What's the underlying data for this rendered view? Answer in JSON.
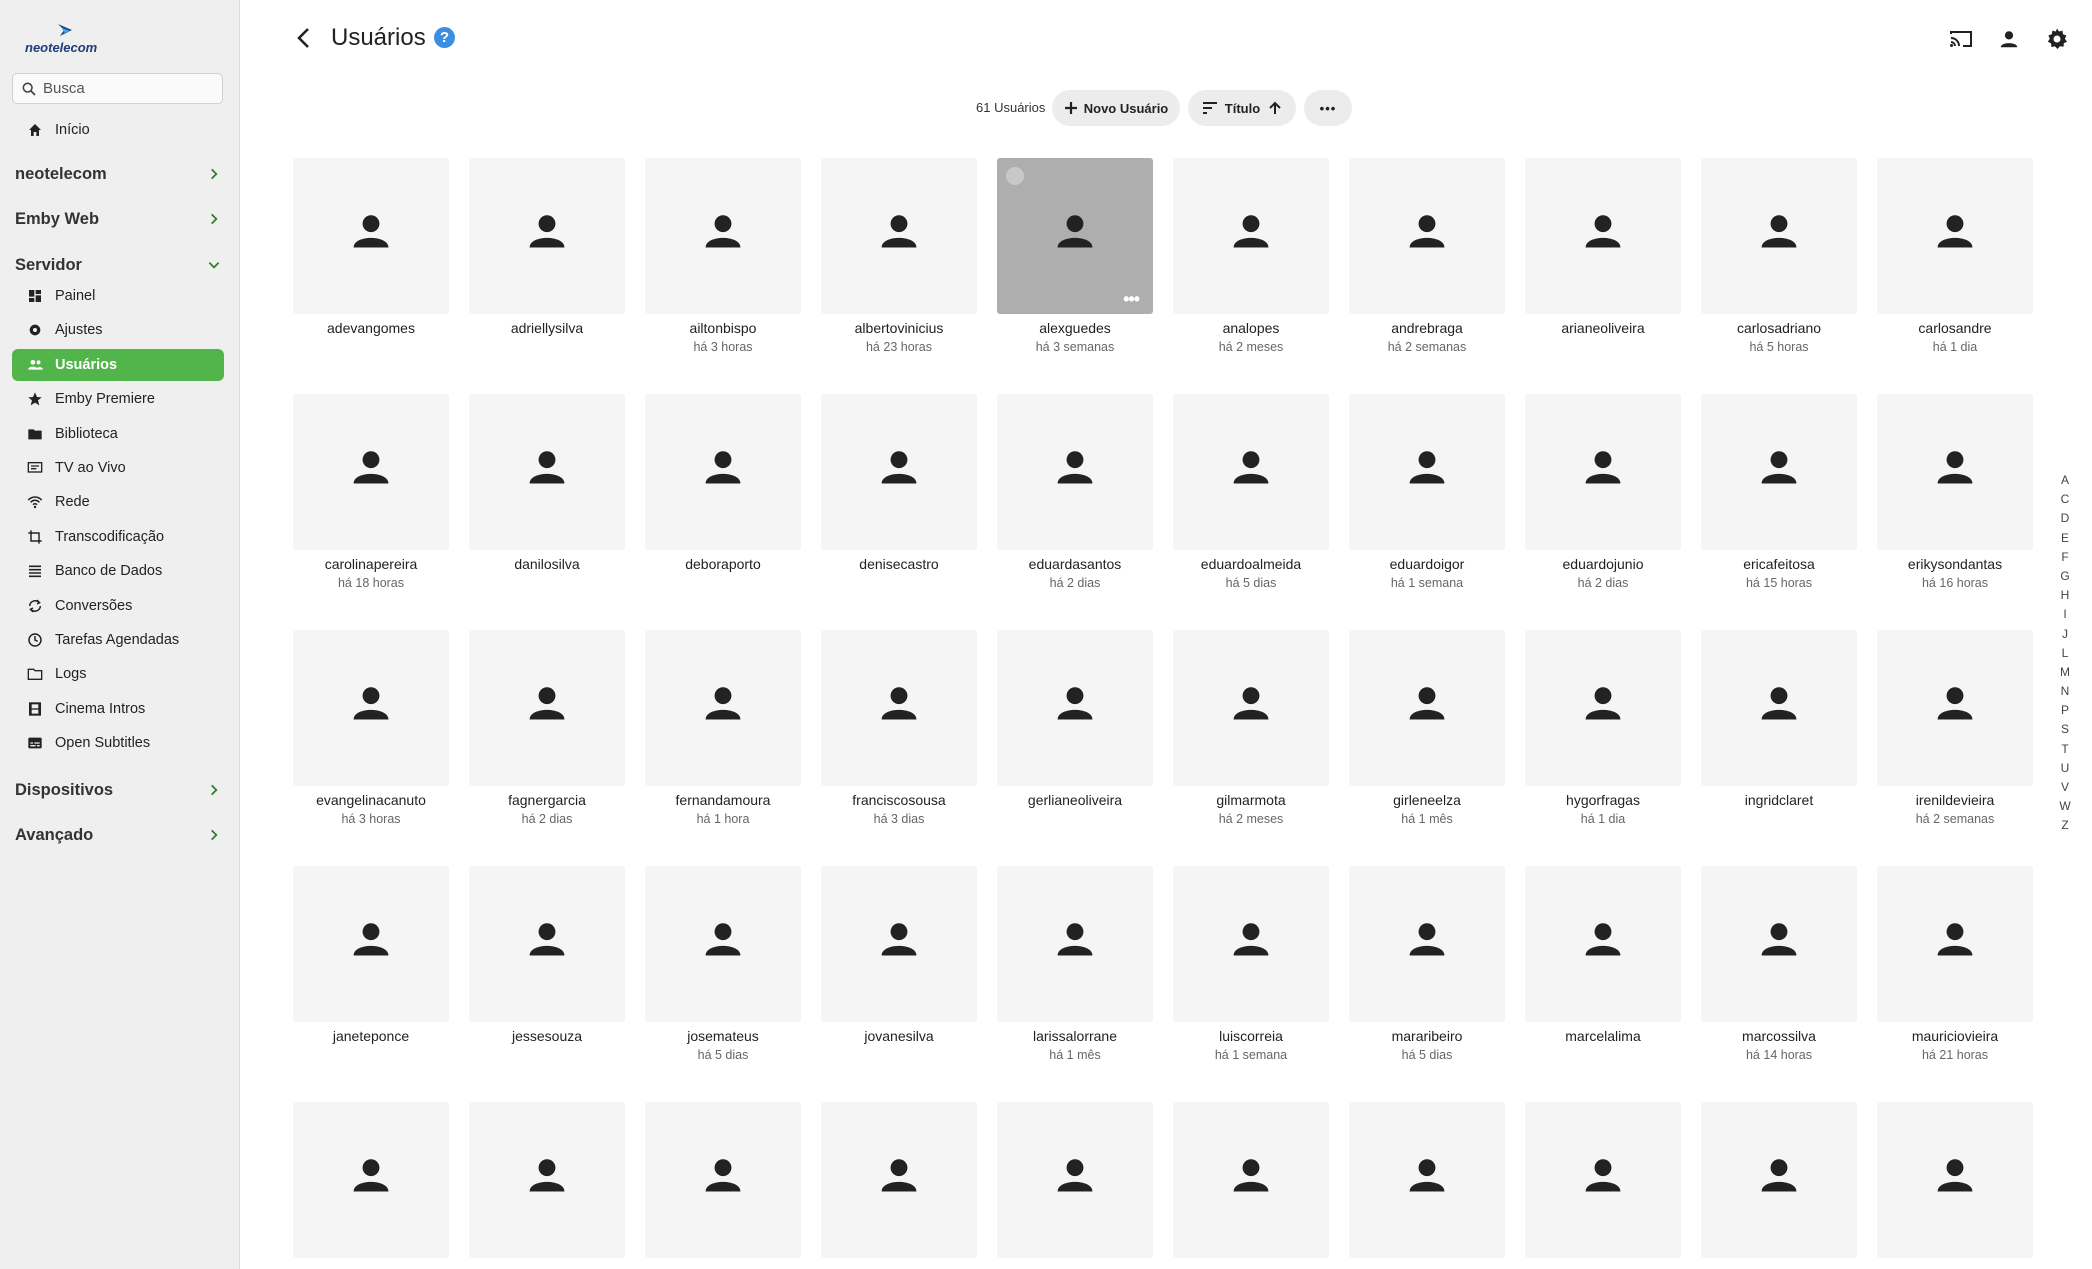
{
  "sidebar": {
    "logo_text": "neotelecom",
    "search_placeholder": "Busca",
    "home_label": "Início",
    "sections": {
      "neotelecom": "neotelecom",
      "emby_web": "Emby Web",
      "servidor": "Servidor",
      "dispositivos": "Dispositivos",
      "avancado": "Avançado"
    },
    "items": [
      {
        "label": "Painel",
        "icon": "dashboard-icon"
      },
      {
        "label": "Ajustes",
        "icon": "gear-icon"
      },
      {
        "label": "Usuários",
        "icon": "people-icon",
        "active": true
      },
      {
        "label": "Emby Premiere",
        "icon": "star-icon"
      },
      {
        "label": "Biblioteca",
        "icon": "folder-icon"
      },
      {
        "label": "TV ao Vivo",
        "icon": "tv-guide-icon"
      },
      {
        "label": "Rede",
        "icon": "wifi-icon"
      },
      {
        "label": "Transcodificação",
        "icon": "crop-icon"
      },
      {
        "label": "Banco de Dados",
        "icon": "list-icon"
      },
      {
        "label": "Conversões",
        "icon": "sync-icon"
      },
      {
        "label": "Tarefas Agendadas",
        "icon": "clock-icon"
      },
      {
        "label": "Logs",
        "icon": "folder-outline-icon"
      },
      {
        "label": "Cinema Intros",
        "icon": "film-icon"
      },
      {
        "label": "Open Subtitles",
        "icon": "subtitles-icon"
      }
    ]
  },
  "header": {
    "title": "Usuários",
    "help": "?"
  },
  "toolbar": {
    "count": "61 Usuários",
    "new_user": "Novo Usuário",
    "sort": "Título",
    "more": "•••"
  },
  "users": [
    {
      "name": "adevangomes",
      "sub": ""
    },
    {
      "name": "adriellysilva",
      "sub": ""
    },
    {
      "name": "ailtonbispo",
      "sub": "há 3 horas"
    },
    {
      "name": "albertovinicius",
      "sub": "há 23 horas"
    },
    {
      "name": "alexguedes",
      "sub": "há 3 semanas",
      "hover": true
    },
    {
      "name": "analopes",
      "sub": "há 2 meses"
    },
    {
      "name": "andrebraga",
      "sub": "há 2 semanas"
    },
    {
      "name": "arianeoliveira",
      "sub": ""
    },
    {
      "name": "carlosadriano",
      "sub": "há 5 horas"
    },
    {
      "name": "carlosandre",
      "sub": "há 1 dia"
    },
    {
      "name": "carolinapereira",
      "sub": "há 18 horas"
    },
    {
      "name": "danilosilva",
      "sub": ""
    },
    {
      "name": "deboraporto",
      "sub": ""
    },
    {
      "name": "denisecastro",
      "sub": ""
    },
    {
      "name": "eduardasantos",
      "sub": "há 2 dias"
    },
    {
      "name": "eduardoalmeida",
      "sub": "há 5 dias"
    },
    {
      "name": "eduardoigor",
      "sub": "há 1 semana"
    },
    {
      "name": "eduardojunio",
      "sub": "há 2 dias"
    },
    {
      "name": "ericafeitosa",
      "sub": "há 15 horas"
    },
    {
      "name": "erikysondantas",
      "sub": "há 16 horas"
    },
    {
      "name": "evangelinacanuto",
      "sub": "há 3 horas"
    },
    {
      "name": "fagnergarcia",
      "sub": "há 2 dias"
    },
    {
      "name": "fernandamoura",
      "sub": "há 1 hora"
    },
    {
      "name": "franciscosousa",
      "sub": "há 3 dias"
    },
    {
      "name": "gerlianeoliveira",
      "sub": ""
    },
    {
      "name": "gilmarmota",
      "sub": "há 2 meses"
    },
    {
      "name": "girleneelza",
      "sub": "há 1 mês"
    },
    {
      "name": "hygorfragas",
      "sub": "há 1 dia"
    },
    {
      "name": "ingridclaret",
      "sub": ""
    },
    {
      "name": "irenildevieira",
      "sub": "há 2 semanas"
    },
    {
      "name": "janeteponce",
      "sub": ""
    },
    {
      "name": "jessesouza",
      "sub": ""
    },
    {
      "name": "josemateus",
      "sub": "há 5 dias"
    },
    {
      "name": "jovanesilva",
      "sub": ""
    },
    {
      "name": "larissalorrane",
      "sub": "há 1 mês"
    },
    {
      "name": "luiscorreia",
      "sub": "há 1 semana"
    },
    {
      "name": "mararibeiro",
      "sub": "há 5 dias"
    },
    {
      "name": "marcelalima",
      "sub": ""
    },
    {
      "name": "marcossilva",
      "sub": "há 14 horas"
    },
    {
      "name": "mauriciovieira",
      "sub": "há 21 horas"
    },
    {
      "name": "",
      "sub": ""
    },
    {
      "name": "",
      "sub": ""
    },
    {
      "name": "",
      "sub": ""
    },
    {
      "name": "",
      "sub": ""
    },
    {
      "name": "",
      "sub": ""
    },
    {
      "name": "",
      "sub": ""
    },
    {
      "name": "",
      "sub": ""
    },
    {
      "name": "",
      "sub": ""
    },
    {
      "name": "",
      "sub": ""
    },
    {
      "name": "",
      "sub": ""
    }
  ],
  "alphabet": [
    "A",
    "C",
    "D",
    "E",
    "F",
    "G",
    "H",
    "I",
    "J",
    "L",
    "M",
    "N",
    "P",
    "S",
    "T",
    "U",
    "V",
    "W",
    "Z"
  ],
  "colors": {
    "accent": "#52b54b",
    "help": "#3a8fe0",
    "tile": "#f5f5f5"
  }
}
